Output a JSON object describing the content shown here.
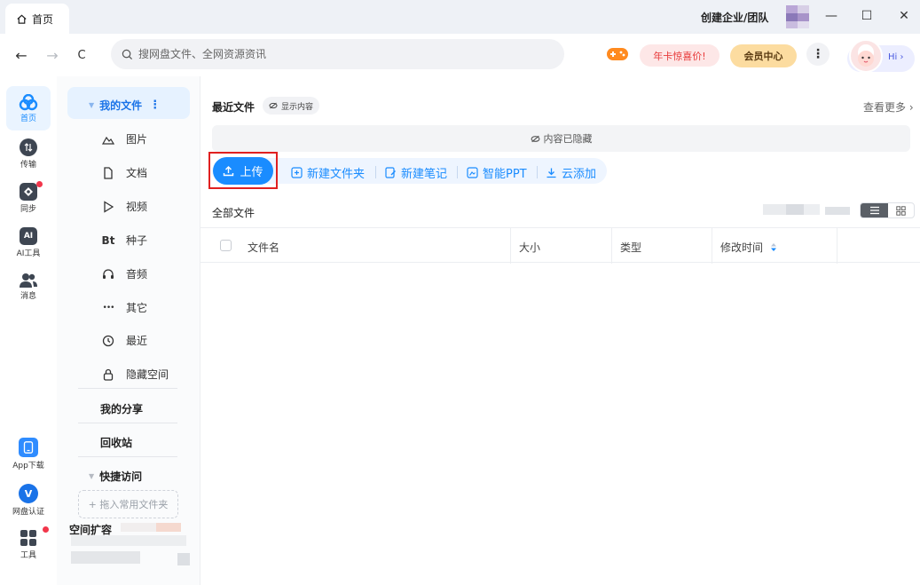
{
  "titlebar": {
    "tab_label": "首页",
    "create_team": "创建企业/团队",
    "minimize": "—",
    "maximize": "☐",
    "close": "✕"
  },
  "navbar": {
    "back": "←",
    "forward": "→",
    "refresh": "C",
    "search_placeholder": "搜网盘文件、全网资源资讯",
    "promo": "年卡惊喜价!",
    "vip": "会员中心",
    "more": "⋮",
    "hi": "Hi ›"
  },
  "rail": {
    "items": [
      {
        "label": "首页",
        "icon": "home-icon"
      },
      {
        "label": "传输",
        "icon": "transfer-icon"
      },
      {
        "label": "同步",
        "icon": "sync-icon"
      },
      {
        "label": "AI工具",
        "icon": "ai-icon"
      },
      {
        "label": "消息",
        "icon": "message-icon"
      },
      {
        "label": "App下载",
        "icon": "app-download-icon"
      },
      {
        "label": "网盘认证",
        "icon": "verify-icon"
      },
      {
        "label": "工具",
        "icon": "tools-icon"
      }
    ],
    "accent": "#1a8cff"
  },
  "tree": {
    "my_files": "我的文件",
    "items": [
      {
        "label": "图片",
        "icon": "image-icon"
      },
      {
        "label": "文档",
        "icon": "document-icon"
      },
      {
        "label": "视频",
        "icon": "video-icon"
      },
      {
        "label": "种子",
        "icon_text": "Bt"
      },
      {
        "label": "音频",
        "icon": "audio-icon"
      },
      {
        "label": "其它",
        "icon_text": "•••"
      },
      {
        "label": "最近",
        "icon": "recent-icon"
      },
      {
        "label": "隐藏空间",
        "icon": "lock-icon"
      }
    ],
    "my_share": "我的分享",
    "recycle": "回收站",
    "quick_access": "快捷访问",
    "drag_hint": "+ 拖入常用文件夹",
    "space_expand": "空间扩容"
  },
  "main": {
    "recent_title": "最近文件",
    "show_content": "显示内容",
    "see_more": "查看更多 ›",
    "hidden_notice": "内容已隐藏",
    "actions": {
      "upload": "上传",
      "new_folder": "新建文件夹",
      "new_note": "新建笔记",
      "smart_ppt": "智能PPT",
      "cloud_add": "云添加"
    },
    "all_files": "全部文件",
    "columns": [
      "文件名",
      "大小",
      "类型",
      "修改时间"
    ]
  }
}
